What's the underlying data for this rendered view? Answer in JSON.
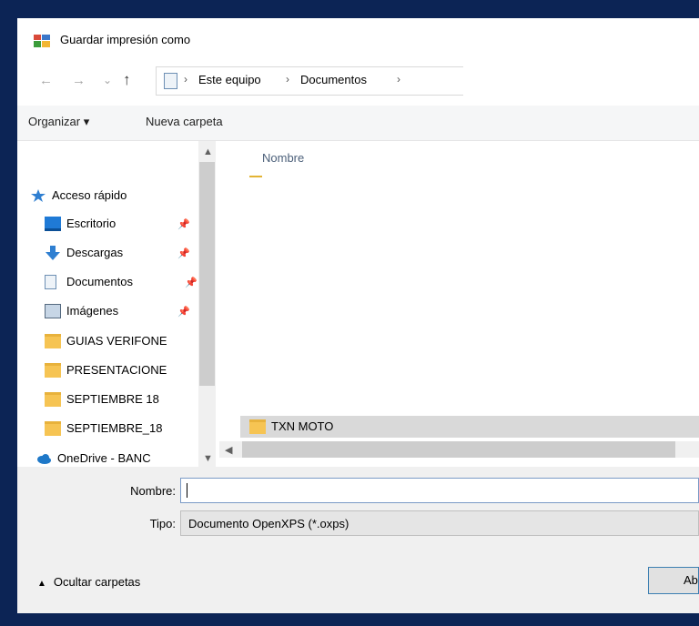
{
  "window": {
    "title": "Guardar impresión como"
  },
  "nav": {
    "back": "←",
    "forward": "→",
    "recent": "⌄",
    "up": "↑"
  },
  "address": {
    "crumbs": [
      "Este equipo",
      "Documentos"
    ],
    "sep": "›"
  },
  "toolbar": {
    "organize_label": "Organizar ▾",
    "new_folder_label": "Nueva carpeta"
  },
  "sidebar": {
    "items": [
      {
        "label": "Acceso rápido",
        "icon": "star-icon"
      },
      {
        "label": "Escritorio",
        "icon": "desktop-icon",
        "pinned": true
      },
      {
        "label": "Descargas",
        "icon": "download-arrow-icon",
        "pinned": true
      },
      {
        "label": "Documentos",
        "icon": "document-icon",
        "pinned": true
      },
      {
        "label": "Imágenes",
        "icon": "pictures-icon",
        "pinned": true
      },
      {
        "label": "GUIAS VERIFONE",
        "icon": "folder-icon"
      },
      {
        "label": "PRESENTACIONE",
        "icon": "folder-icon"
      },
      {
        "label": "SEPTIEMBRE 18",
        "icon": "folder-icon"
      },
      {
        "label": "SEPTIEMBRE_18",
        "icon": "folder-icon"
      },
      {
        "label": "OneDrive - BANC",
        "icon": "cloud-icon"
      }
    ],
    "pin_glyph": "📌"
  },
  "filelist": {
    "column_name": "Nombre",
    "rows": [
      {
        "name": "TXN MOTO",
        "icon": "folder-icon",
        "selected": true
      }
    ]
  },
  "form": {
    "name_label": "Nombre:",
    "name_value": "",
    "type_label": "Tipo:",
    "type_value": "Documento OpenXPS (*.oxps)"
  },
  "footer": {
    "hide_folders_label": "Ocultar carpetas",
    "save_label": "Abrir"
  },
  "colors": {
    "frame": "#0c2455",
    "selection": "#d9d9d9",
    "folder": "#f6c453",
    "accent": "#3c7fb1"
  }
}
